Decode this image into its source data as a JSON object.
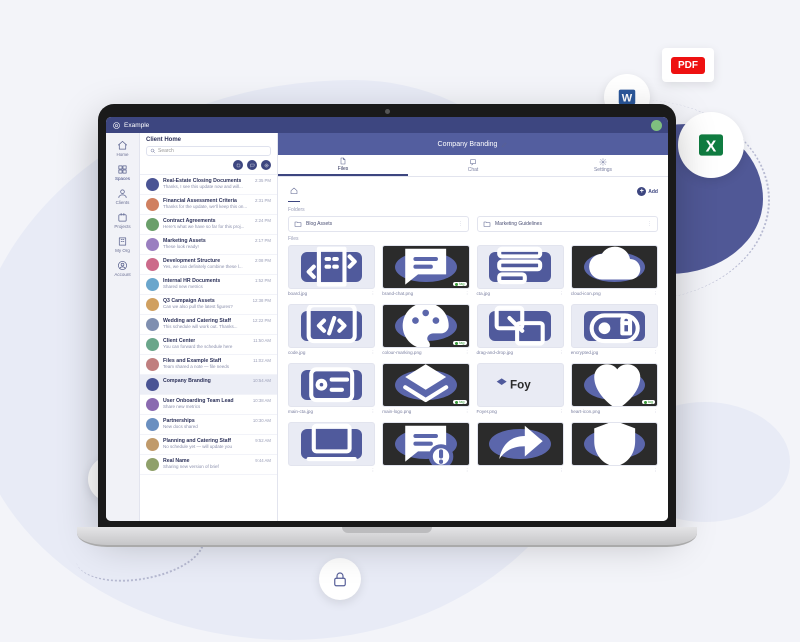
{
  "app": {
    "brand": "Example"
  },
  "nav": [
    {
      "icon": "home",
      "label": "Home"
    },
    {
      "icon": "spaces",
      "label": "Spaces"
    },
    {
      "icon": "clients",
      "label": "Clients"
    },
    {
      "icon": "projects",
      "label": "Projects"
    },
    {
      "icon": "org",
      "label": "My Org"
    },
    {
      "icon": "account",
      "label": "Account"
    }
  ],
  "conversations": {
    "title": "Client Home",
    "search_placeholder": "Search",
    "items": [
      {
        "name": "Real-Estate Closing Documents",
        "sub": "Thanks, I see this update now and will...",
        "time": "2:35 PM"
      },
      {
        "name": "Financial Assessment Criteria",
        "sub": "Thanks for the update, we'll keep this on...",
        "time": "2:31 PM"
      },
      {
        "name": "Contract Agreements",
        "sub": "Here's what we have so far for this proj...",
        "time": "2:24 PM"
      },
      {
        "name": "Marketing Assets",
        "sub": "These look ready!",
        "time": "2:17 PM"
      },
      {
        "name": "Development Structure",
        "sub": "Yes, we can definitely combine these l...",
        "time": "2:08 PM"
      },
      {
        "name": "Internal HR Documents",
        "sub": "Shared new metrics",
        "time": "1:52 PM"
      },
      {
        "name": "Q3 Campaign Assets",
        "sub": "Can we also pull the latest figures?",
        "time": "12:38 PM"
      },
      {
        "name": "Wedding and Catering Staff",
        "sub": "This schedule will work out. Thanks...",
        "time": "12:22 PM"
      },
      {
        "name": "Client Center",
        "sub": "You can forward the schedule here",
        "time": "11:50 AM"
      },
      {
        "name": "Files and Example Staff",
        "sub": "Team shared a note — file needs",
        "time": "11:02 AM"
      },
      {
        "name": "Company Branding",
        "sub": "",
        "time": "10:54 AM"
      },
      {
        "name": "User Onboarding Team Lead",
        "sub": "Share new metrics",
        "time": "10:38 AM"
      },
      {
        "name": "Partnerships",
        "sub": "New docs shared",
        "time": "10:30 AM"
      },
      {
        "name": "Planning and Catering Staff",
        "sub": "No schedule yet — will update you",
        "time": "9:52 AM"
      },
      {
        "name": "Real Name",
        "sub": "Sharing new version of brief",
        "time": "9:44 AM"
      }
    ]
  },
  "space": {
    "title": "Company Branding",
    "tabs": [
      {
        "icon": "files",
        "label": "Files"
      },
      {
        "icon": "chat",
        "label": "Chat"
      },
      {
        "icon": "settings",
        "label": "Settings"
      }
    ],
    "add_label": "Add",
    "folders_label": "Folders",
    "folders": [
      "Blog Assets",
      "Marketing Guidelines"
    ],
    "files_label": "Files",
    "files": [
      {
        "name": "board.jpg",
        "dark": false,
        "shape": "building"
      },
      {
        "name": "brand-chat.png",
        "dark": true,
        "shape": "chat",
        "tagged": true
      },
      {
        "name": "cta.jpg",
        "dark": false,
        "shape": "list"
      },
      {
        "name": "cloud-icon.png",
        "dark": true,
        "shape": "cloud"
      },
      {
        "name": "code.jpg",
        "dark": false,
        "shape": "codewin"
      },
      {
        "name": "colour-marking.png",
        "dark": true,
        "shape": "palette",
        "tagged": true
      },
      {
        "name": "drag-and-drop.jpg",
        "dark": false,
        "shape": "upload"
      },
      {
        "name": "encrypted.jpg",
        "dark": false,
        "shape": "lockcard"
      },
      {
        "name": "main-cta.jpg",
        "dark": false,
        "shape": "card"
      },
      {
        "name": "main-logo.png",
        "dark": true,
        "shape": "logo",
        "tagged": true
      },
      {
        "name": "Foyer.png",
        "dark": false,
        "shape": "foy"
      },
      {
        "name": "heart-icon.png",
        "dark": true,
        "shape": "heart",
        "tagged": true
      },
      {
        "name": "",
        "dark": false,
        "shape": "laptop"
      },
      {
        "name": "",
        "dark": true,
        "shape": "chatwarn"
      },
      {
        "name": "",
        "dark": true,
        "shape": "share"
      },
      {
        "name": "",
        "dark": true,
        "shape": "shield"
      }
    ]
  }
}
